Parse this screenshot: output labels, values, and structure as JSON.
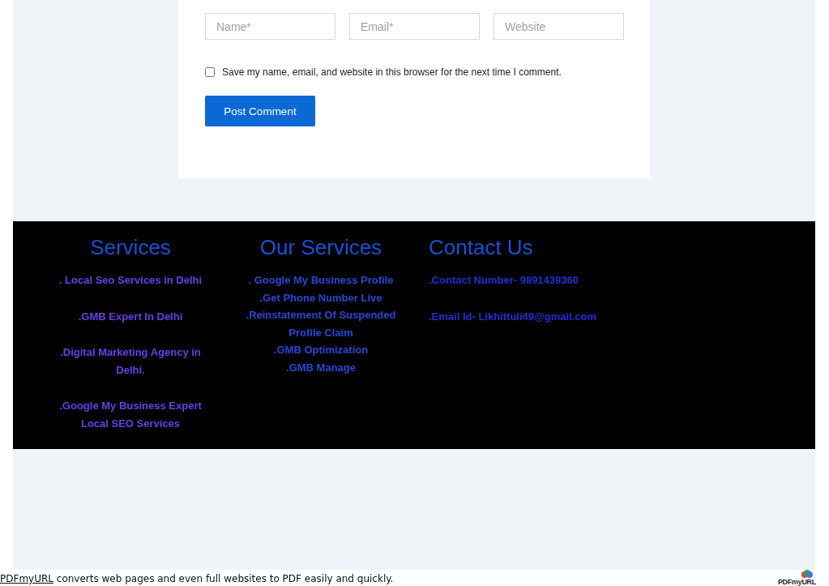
{
  "comment_form": {
    "fields": [
      {
        "placeholder": "Name*"
      },
      {
        "placeholder": "Email*"
      },
      {
        "placeholder": "Website"
      }
    ],
    "remember": {
      "label": "Save my name, email, and website in this browser for the next time I comment.",
      "checked": false
    },
    "submit": "Post Comment"
  },
  "footer": {
    "columns": [
      {
        "kind": "centered",
        "heading": "Services",
        "items": [
          ". Local Seo  Services in Delhi",
          ".GMB Expert In Delhi",
          ".Digital Marketing Agency in Delhi.",
          ".Google My Business Expert Local SEO Services"
        ]
      },
      {
        "kind": "compact",
        "heading": "Our Services",
        "items": [
          ". Google My Business Profile",
          ".Get Phone Number Live",
          ".Reinstatement Of Suspended Profile Claim",
          ".GMB Optimization",
          ".GMB Manage"
        ]
      },
      {
        "kind": "left",
        "heading": "Contact Us",
        "items": [
          ".Contact Number- 9891439360",
          ".Email Id- Likhittuli49@gmail.com"
        ]
      }
    ]
  },
  "pdf_footer": {
    "link": "PDFmyURL",
    "text": "converts web pages and even full websites to PDF easily and quickly.",
    "logo": "PDFmyURL"
  }
}
